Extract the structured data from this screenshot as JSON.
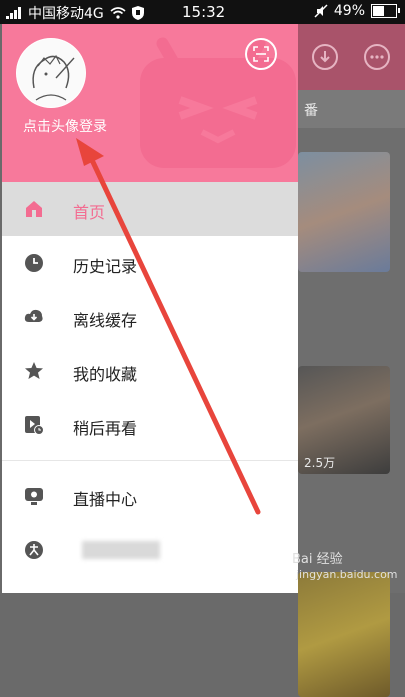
{
  "status_bar": {
    "carrier": "中国移动4G",
    "time": "15:32",
    "battery": "49%"
  },
  "drawer": {
    "login_text": "点击头像登录",
    "menu": [
      {
        "label": "首页"
      },
      {
        "label": "历史记录"
      },
      {
        "label": "离线缓存"
      },
      {
        "label": "我的收藏"
      },
      {
        "label": "稍后再看"
      },
      {
        "label": "直播中心"
      }
    ]
  },
  "background": {
    "tab_label": "番",
    "card_views": "2.5万"
  },
  "watermark": {
    "line1": "Bai 经验",
    "line2": "jingyan.baidu.com"
  },
  "colors": {
    "brand": "#f7799b",
    "active": "#f36c91"
  }
}
